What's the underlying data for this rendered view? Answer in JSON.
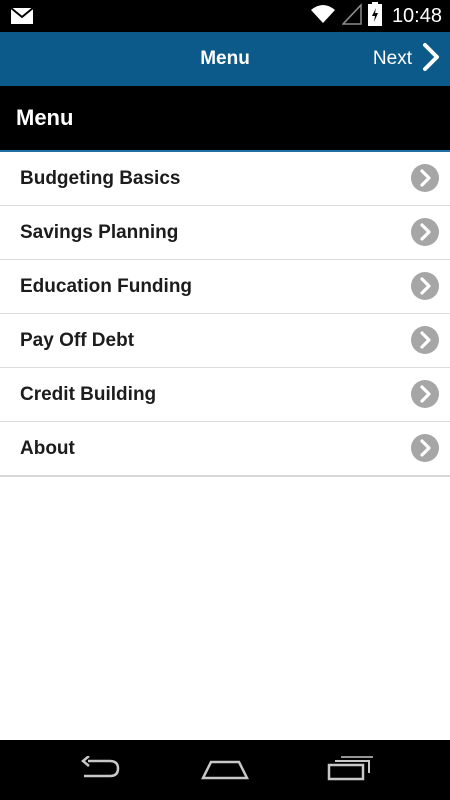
{
  "status_bar": {
    "time": "10:48",
    "icons": [
      "mail-icon",
      "wifi-icon",
      "signal-icon",
      "battery-icon"
    ]
  },
  "action_bar": {
    "title": "Menu",
    "next_label": "Next"
  },
  "section": {
    "title": "Menu"
  },
  "menu": {
    "items": [
      {
        "label": "Budgeting Basics"
      },
      {
        "label": "Savings Planning"
      },
      {
        "label": "Education Funding"
      },
      {
        "label": "Pay Off Debt"
      },
      {
        "label": "Credit Building"
      },
      {
        "label": "About"
      }
    ]
  },
  "nav_bar": {
    "icons": [
      "back-icon",
      "home-icon",
      "recent-apps-icon"
    ]
  },
  "colors": {
    "action_bar": "#0b5a8a",
    "header": "#000000",
    "chevron": "#a6a6a6"
  }
}
